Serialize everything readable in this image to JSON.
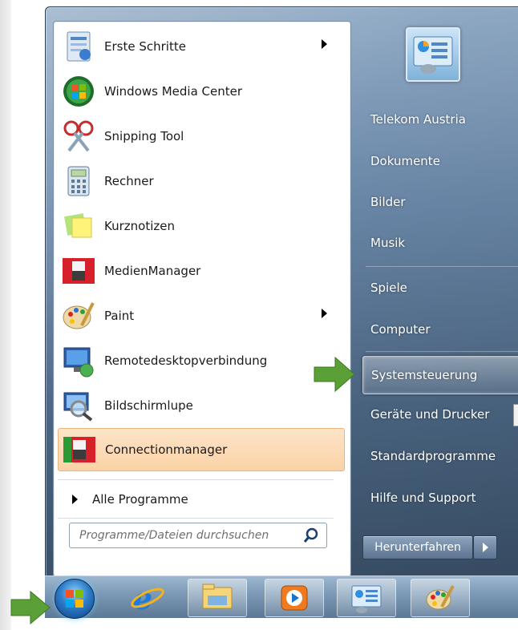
{
  "programs": [
    {
      "label": "Erste Schritte",
      "icon": "getting-started-icon",
      "submenu": true
    },
    {
      "label": "Windows Media Center",
      "icon": "media-center-icon",
      "submenu": false
    },
    {
      "label": "Snipping Tool",
      "icon": "snipping-tool-icon",
      "submenu": false
    },
    {
      "label": "Rechner",
      "icon": "calculator-icon",
      "submenu": false
    },
    {
      "label": "Kurznotizen",
      "icon": "sticky-notes-icon",
      "submenu": false
    },
    {
      "label": "MedienManager",
      "icon": "telekom-austria-icon",
      "submenu": false
    },
    {
      "label": "Paint",
      "icon": "paint-palette-icon",
      "submenu": true
    },
    {
      "label": "Remotedesktopverbindung",
      "icon": "remote-desktop-icon",
      "submenu": false
    },
    {
      "label": "Bildschirmlupe",
      "icon": "magnifier-icon",
      "submenu": false
    },
    {
      "label": "Connectionmanager",
      "icon": "telekom-austria-icon",
      "submenu": false,
      "highlighted": true
    }
  ],
  "all_programs_label": "Alle Programme",
  "search": {
    "placeholder": "Programme/Dateien durchsuchen",
    "value": ""
  },
  "right_items": [
    {
      "label": "Telekom Austria"
    },
    {
      "label": "Dokumente"
    },
    {
      "label": "Bilder"
    },
    {
      "label": "Musik"
    },
    {
      "label": "Spiele"
    },
    {
      "label": "Computer"
    },
    {
      "label": "Systemsteuerung",
      "selected": true
    },
    {
      "label": "Geräte und Drucker"
    },
    {
      "label": "Standardprogramme"
    },
    {
      "label": "Hilfe und Support"
    }
  ],
  "shutdown_label": "Herunterfahren",
  "taskbar": [
    {
      "icon": "start-orb-icon"
    },
    {
      "icon": "internet-explorer-icon"
    },
    {
      "icon": "windows-explorer-icon"
    },
    {
      "icon": "media-player-icon"
    },
    {
      "icon": "control-panel-icon"
    },
    {
      "icon": "paint-palette-icon"
    }
  ],
  "colors": {
    "highlight": "#fbd2a6",
    "accent_arrow": "#5aa037",
    "menu_glass": "#4c6784"
  }
}
